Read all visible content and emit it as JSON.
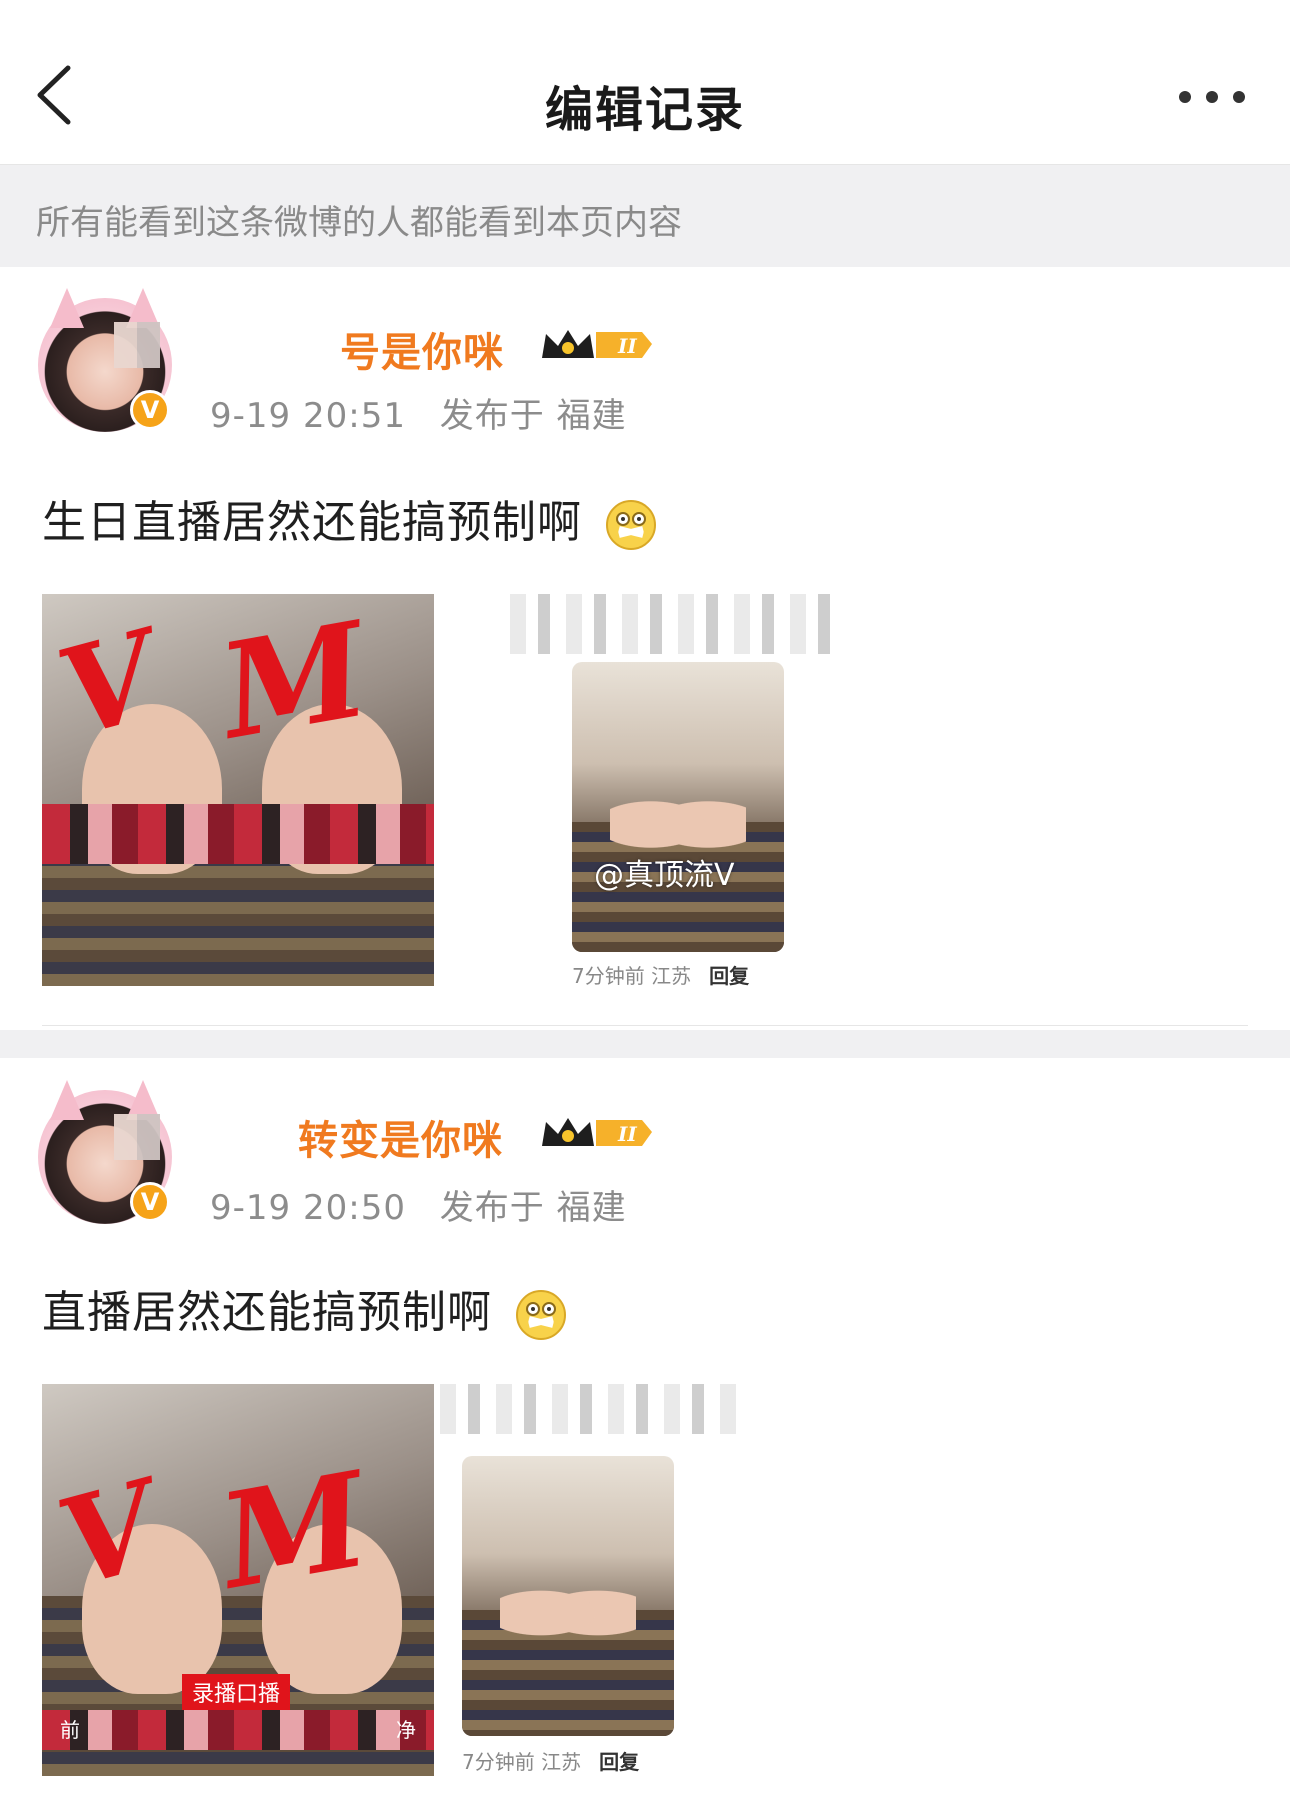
{
  "nav": {
    "title": "编辑记录"
  },
  "notice": "所有能看到这条微博的人都能看到本页内容",
  "posts": [
    {
      "username": "号是你咪",
      "time": "9-19 20:51",
      "location": "发布于 福建",
      "text": "生日直播居然还能搞预制啊",
      "right_caption_time": "7分钟前 江苏",
      "right_caption_reply": "回复",
      "watermark": "@真顶流V"
    },
    {
      "username": "转变是你咪",
      "time": "9-19 20:50",
      "location": "发布于 福建",
      "text": "直播居然还能搞预制啊",
      "right_caption_time": "7分钟前 江苏",
      "right_caption_reply": "回复",
      "mosaic_label": "录播口播",
      "mosaic_left": "前",
      "mosaic_right": "净"
    }
  ],
  "colors": {
    "username": "#f07a1f",
    "notice_bg": "#f0f0f2",
    "verified": "#f6a318"
  },
  "icons": [
    "back-icon",
    "more-icon",
    "crown-badge-icon",
    "verified-icon",
    "emoji-shush-icon"
  ]
}
